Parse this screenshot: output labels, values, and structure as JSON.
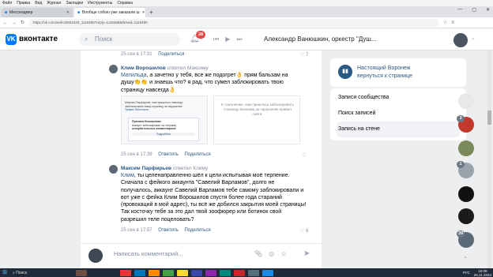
{
  "browser": {
    "menu": [
      "Файл",
      "Правка",
      "Вид",
      "Журнал",
      "Закладки",
      "Инструменты",
      "Справка"
    ],
    "tabs": [
      {
        "title": "Мессенджер",
        "active": false
      },
      {
        "title": "Вообще собою уже заказали ш",
        "active": true
      }
    ],
    "new_tab": "+",
    "url": "https://vk.com/wall-20824420_1116480?reply=1116488&thread=1116480",
    "window_controls": [
      "—",
      "▢",
      "✕"
    ]
  },
  "vk_header": {
    "logo_letter": "VK",
    "brand": "вконтакте",
    "search_placeholder": "Поиск",
    "notifications_count": "28",
    "now_playing": "Александр Ванюшкин, оркестр \"Душ..."
  },
  "comments": [
    {
      "date": "25 сен в 17:31",
      "share": "Поделиться",
      "likes": "7"
    },
    {
      "author": "Клим Ворошилов",
      "replied_word": "ответил",
      "replied_to": "Максиму",
      "mention": "Матильда",
      "text": ", а зачетно у тебя, все же подогрет👌 прям бальзам на душу👏👏 и знаешь что? я рад, что сумел заблокировать твою страницу навсегда👌",
      "image_left_lines": [
        "Максим Парфирьев, нам пришлось навсегда",
        "заблокировать вашу страницу за нарушение",
        "Правил ВКонтакте."
      ],
      "image_left_box": [
        "Причина блокировки",
        "Аккаунт заблокирован за отправку",
        "оскорбительных комментариев",
        "Подробнее"
      ],
      "image_right": "К сожалению, нам пришлось заблокировать страницу Максима за нарушение правил сайта.",
      "date": "25 сен в 17:39",
      "answer": "Ответить",
      "share": "Поделиться"
    },
    {
      "author": "Максим Парфирьев",
      "replied_word": "ответил",
      "replied_to": "Климу",
      "mention": "Клим",
      "text": ", ты целенаправленно шёл к цели испытывая моё терпение. Сначала с фейкого аккаунта \"Савелий Варламов\", долго не получалось, аккаунт Савелий Варламов тебе самому заблокировали и вот уже с фейка Клим Ворошилов спустя более года стараний (провокаций в мой адрес), ты всё же добился закрытия моей страницы! Так косточку тебе за это дал твой зоофюрер или ботинок свой разрешил теле поцеловать?",
      "date": "25 сен в 17:57",
      "answer": "Ответить",
      "share": "Поделиться",
      "likes": "6"
    }
  ],
  "composer": {
    "placeholder": "Написать комментарий..."
  },
  "right_panel": {
    "group_name": "Настоящий Воронеж",
    "back_link": "вернуться к странице",
    "menu": [
      {
        "label": "Записи сообщества",
        "active": false
      },
      {
        "label": "Поиск записей",
        "active": false
      },
      {
        "label": "Запись на стене",
        "active": true
      }
    ]
  },
  "friend_badges": [
    "3",
    "1",
    "39"
  ],
  "taskbar": {
    "search": "Поиск",
    "lang": "РУС",
    "time": "15:09",
    "date": "26.11.2024"
  }
}
